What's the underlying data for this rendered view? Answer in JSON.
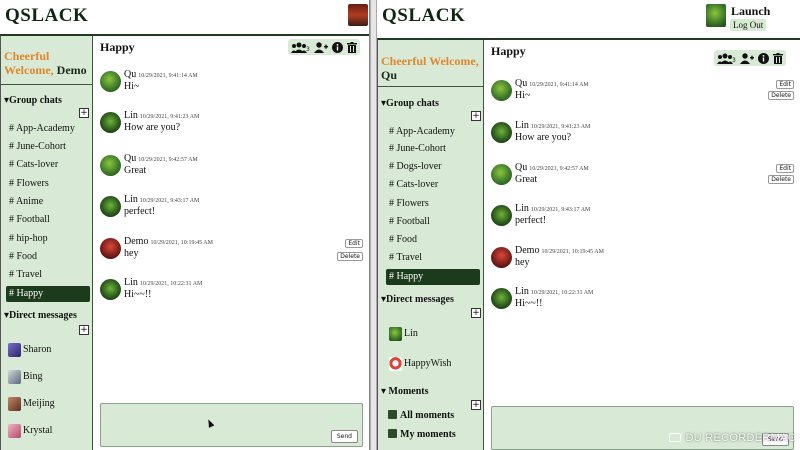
{
  "app": {
    "logo": "QSLACK"
  },
  "left": {
    "welcome_prefix": "Cheerful Welcome,",
    "username": "Demo",
    "group_chats_header": "Group chats",
    "channels": [
      "# App-Academy",
      "# June-Cohort",
      "# Cats-lover",
      "# Flowers",
      "# Anime",
      "# Football",
      "# hip-hop",
      "# Food",
      "# Travel",
      "# Happy"
    ],
    "active_channel": "# Happy",
    "direct_messages_header": "Direct messages",
    "dms": [
      "Sharon",
      "Bing",
      "Meijing",
      "Krystal"
    ],
    "chat_title": "Happy",
    "member_count": "3",
    "messages": [
      {
        "user": "Qu",
        "time": "10/29/2021, 9:41:14 AM",
        "text": "Hi~"
      },
      {
        "user": "Lin",
        "time": "10/29/2021, 9:41:23 AM",
        "text": "How are you?"
      },
      {
        "user": "Qu",
        "time": "10/29/2021, 9:42:57 AM",
        "text": "Great"
      },
      {
        "user": "Lin",
        "time": "10/29/2021, 9:43:17 AM",
        "text": "perfect!"
      },
      {
        "user": "Demo",
        "time": "10/29/2021, 10:19:45 AM",
        "text": "hey"
      },
      {
        "user": "Lin",
        "time": "10/29/2021, 10:22:31 AM",
        "text": "Hi~~!!"
      }
    ],
    "edit_label": "Edit",
    "delete_label": "Delete",
    "send_label": "Send"
  },
  "right": {
    "user_display": "Launch",
    "logout_label": "Log Out",
    "welcome_prefix": "Cheerful Welcome,",
    "username": "Qu",
    "group_chats_header": "Group chats",
    "channels": [
      "# App-Academy",
      "# June-Cohort",
      "# Dogs-lover",
      "# Cats-lover",
      "# Flowers",
      "# Football",
      "# Food",
      "# Travel",
      "# Happy"
    ],
    "active_channel": "# Happy",
    "direct_messages_header": "Direct messages",
    "dms": [
      "Lin",
      "HappyWish"
    ],
    "moments_header": "Moments",
    "moments": [
      "All moments",
      "My moments"
    ],
    "chat_title": "Happy",
    "member_count": "3",
    "messages": [
      {
        "user": "Qu",
        "time": "10/29/2021, 9:41:14 AM",
        "text": "Hi~"
      },
      {
        "user": "Lin",
        "time": "10/29/2021, 9:41:23 AM",
        "text": "How are you?"
      },
      {
        "user": "Qu",
        "time": "10/29/2021, 9:42:57 AM",
        "text": "Great"
      },
      {
        "user": "Lin",
        "time": "10/29/2021, 9:43:17 AM",
        "text": "perfect!"
      },
      {
        "user": "Demo",
        "time": "10/29/2021, 10:19:45 AM",
        "text": "hey"
      },
      {
        "user": "Lin",
        "time": "10/29/2021, 10:22:31 AM",
        "text": "Hi~~!!"
      }
    ],
    "edit_label": "Edit",
    "delete_label": "Delete",
    "send_label": "Send"
  },
  "watermark": "DU RECORDER",
  "watermark_suffix": "MAC",
  "icons": {
    "members": "group-icon",
    "add_member": "add-user-icon",
    "info": "info-icon",
    "delete": "trash-icon"
  },
  "colors": {
    "brand_green": "#1c3a1c",
    "sidebar_bg": "#d8ead6",
    "welcome_orange": "#e0862d"
  }
}
